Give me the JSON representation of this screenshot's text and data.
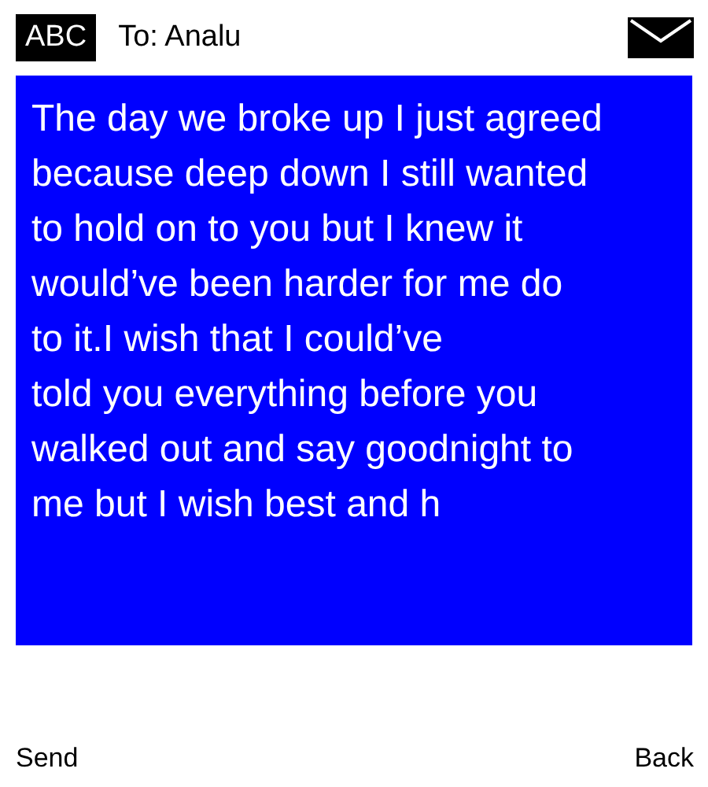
{
  "header": {
    "input_mode": "ABC",
    "recipient": "To: Analu"
  },
  "message": {
    "lines": [
      "The day we broke up I just agreed",
      "because deep down I still wanted",
      "to hold on to you but I knew it",
      "would’ve been harder for me do",
      "to it.I wish that I could’ve",
      "told you everything before you",
      "walked out and say goodnight to",
      "me but I wish best and h"
    ]
  },
  "softkeys": {
    "left": "Send",
    "right": "Back"
  }
}
